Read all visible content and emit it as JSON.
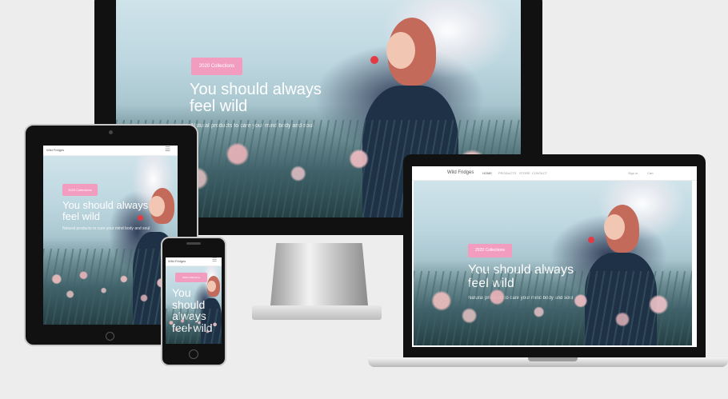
{
  "site": {
    "brand": "Wild Fridges",
    "hero": {
      "button_label": "2020 Collections",
      "title": "You should always feel wild",
      "subtitle": "Natural products to care your mind body and soul"
    },
    "nav": {
      "items": [
        "HOME",
        "PRODUCTS",
        "STORE",
        "CONTACT"
      ],
      "right": [
        "Sign in",
        "Cart"
      ]
    },
    "colors": {
      "accent_pink": "#f29dc0",
      "device_black": "#111111",
      "background": "#ededed"
    }
  }
}
